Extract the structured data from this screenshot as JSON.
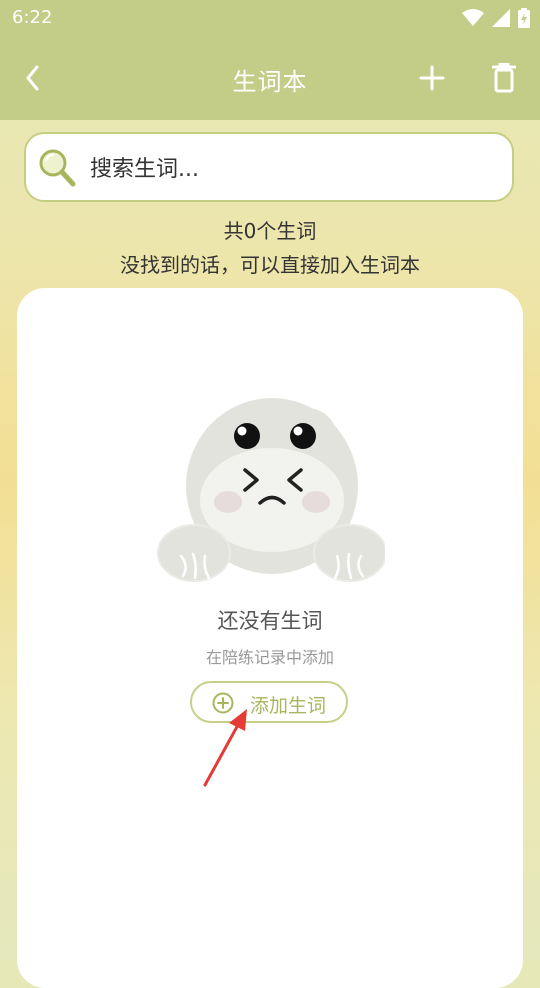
{
  "status_bar": {
    "time": "6:22",
    "icons": [
      "wifi-icon",
      "signal-icon",
      "battery-charging-icon"
    ]
  },
  "app_bar": {
    "title": "生词本",
    "back_icon": "back-chevron-icon",
    "add_icon": "plus-icon",
    "delete_icon": "trash-icon"
  },
  "search": {
    "placeholder": "搜索生词...",
    "value": "",
    "icon": "search-icon"
  },
  "summary": {
    "count_text": "共0个生词",
    "hint_text": "没找到的话，可以直接加入生词本"
  },
  "empty_state": {
    "illustration": "sad-frog-illustration",
    "title": "还没有生词",
    "subtitle": "在陪练记录中添加",
    "add_button_label": "添加生词",
    "add_button_icon": "plus-circle-icon"
  },
  "colors": {
    "accent": "#c3cd87",
    "button_text": "#a9b55d",
    "annotation_arrow": "#e53a35"
  }
}
